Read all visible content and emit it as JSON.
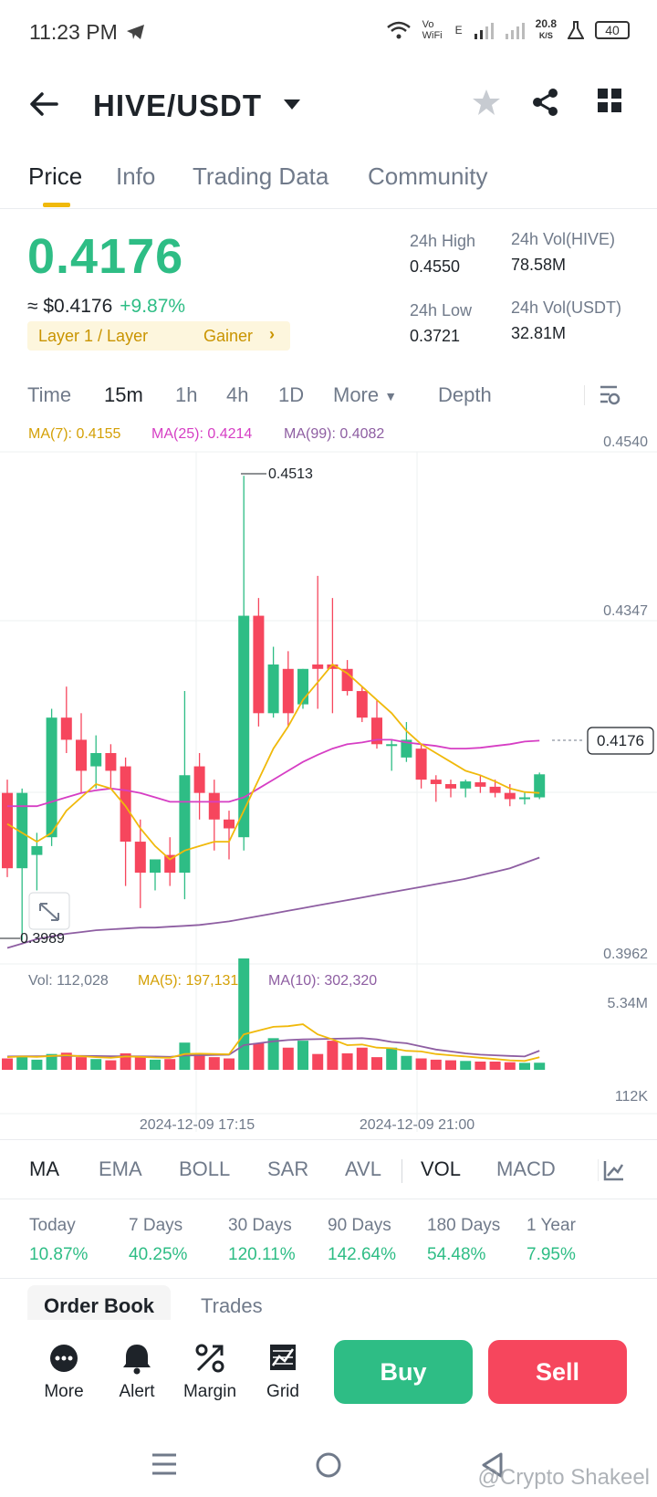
{
  "status_bar": {
    "time": "11:23 PM",
    "net_speed": "20.8",
    "net_unit": "K/S",
    "battery": "40",
    "wifi_label": "Vo WiFi",
    "signal_label": "E"
  },
  "header": {
    "pair": "HIVE/USDT"
  },
  "tabs": [
    {
      "label": "Price",
      "active": true
    },
    {
      "label": "Info",
      "active": false
    },
    {
      "label": "Trading Data",
      "active": false
    },
    {
      "label": "Community",
      "active": false
    }
  ],
  "price": {
    "last": "0.4176",
    "usd": "≈ $0.4176",
    "change": "+9.87%",
    "tag1": "Layer 1 / Layer",
    "tag2": "Gainer",
    "color_up": "#2ebd85",
    "color_down": "#f6465d"
  },
  "stats": {
    "high_label": "24h High",
    "high": "0.4550",
    "low_label": "24h Low",
    "low": "0.3721",
    "vol_base_label": "24h Vol(HIVE)",
    "vol_base": "78.58M",
    "vol_quote_label": "24h Vol(USDT)",
    "vol_quote": "32.81M"
  },
  "intervals": {
    "time": "Time",
    "m15": "15m",
    "h1": "1h",
    "h4": "4h",
    "d1": "1D",
    "more": "More",
    "depth": "Depth",
    "active": "15m"
  },
  "ma_legend": {
    "ma7": "MA(7): 0.4155",
    "ma25": "MA(25): 0.4214",
    "ma99": "MA(99): 0.4082",
    "ma7_color": "#f0b90b",
    "ma25_color": "#d63ec4",
    "ma99_color": "#8e5ea2"
  },
  "vol_legend": {
    "vol": "Vol: 112,028",
    "ma5": "MA(5): 197,131",
    "ma10": "MA(10): 302,320"
  },
  "chart_data": {
    "type": "candlestick",
    "y_axis_labels": [
      "0.4540",
      "0.4347",
      "0.3962"
    ],
    "ylim": [
      0.3962,
      0.454
    ],
    "last_price_label": "0.4176",
    "high_marker": "0.4513",
    "low_marker": "0.3989",
    "x_axis_labels": [
      "2024-12-09 17:15",
      "2024-12-09 21:00"
    ],
    "volume_axis_labels": [
      "5.34M",
      "112K"
    ],
    "candles": [
      {
        "o": 0.4155,
        "h": 0.417,
        "c": 0.407,
        "l": 0.406
      },
      {
        "o": 0.407,
        "h": 0.416,
        "c": 0.4155,
        "l": 0.3989
      },
      {
        "o": 0.4085,
        "h": 0.411,
        "c": 0.4095,
        "l": 0.4045
      },
      {
        "o": 0.4105,
        "h": 0.425,
        "c": 0.424,
        "l": 0.4095
      },
      {
        "o": 0.424,
        "h": 0.4275,
        "c": 0.4215,
        "l": 0.42
      },
      {
        "o": 0.4215,
        "h": 0.4245,
        "c": 0.418,
        "l": 0.4155
      },
      {
        "o": 0.4185,
        "h": 0.422,
        "c": 0.42,
        "l": 0.416
      },
      {
        "o": 0.42,
        "h": 0.421,
        "c": 0.418,
        "l": 0.416
      },
      {
        "o": 0.4185,
        "h": 0.4195,
        "c": 0.41,
        "l": 0.405
      },
      {
        "o": 0.41,
        "h": 0.4125,
        "c": 0.4065,
        "l": 0.4025
      },
      {
        "o": 0.4065,
        "h": 0.408,
        "c": 0.408,
        "l": 0.4045
      },
      {
        "o": 0.4085,
        "h": 0.4105,
        "c": 0.4065,
        "l": 0.405
      },
      {
        "o": 0.4065,
        "h": 0.427,
        "c": 0.4175,
        "l": 0.4035
      },
      {
        "o": 0.4185,
        "h": 0.42,
        "c": 0.4155,
        "l": 0.4125
      },
      {
        "o": 0.4155,
        "h": 0.417,
        "c": 0.4125,
        "l": 0.409
      },
      {
        "o": 0.4125,
        "h": 0.4135,
        "c": 0.4115,
        "l": 0.408
      },
      {
        "o": 0.4105,
        "h": 0.4513,
        "c": 0.4355,
        "l": 0.409
      },
      {
        "o": 0.4355,
        "h": 0.4375,
        "c": 0.4245,
        "l": 0.423
      },
      {
        "o": 0.4245,
        "h": 0.432,
        "c": 0.43,
        "l": 0.424
      },
      {
        "o": 0.4295,
        "h": 0.4315,
        "c": 0.4245,
        "l": 0.423
      },
      {
        "o": 0.4255,
        "h": 0.4295,
        "c": 0.4295,
        "l": 0.425
      },
      {
        "o": 0.43,
        "h": 0.44,
        "c": 0.4295,
        "l": 0.425
      },
      {
        "o": 0.43,
        "h": 0.4375,
        "c": 0.4295,
        "l": 0.4245
      },
      {
        "o": 0.4295,
        "h": 0.4305,
        "c": 0.427,
        "l": 0.4265
      },
      {
        "o": 0.427,
        "h": 0.4275,
        "c": 0.424,
        "l": 0.4235
      },
      {
        "o": 0.424,
        "h": 0.426,
        "c": 0.421,
        "l": 0.4205
      },
      {
        "o": 0.421,
        "h": 0.4215,
        "c": 0.421,
        "l": 0.418
      },
      {
        "o": 0.4195,
        "h": 0.4235,
        "c": 0.4215,
        "l": 0.419
      },
      {
        "o": 0.4205,
        "h": 0.421,
        "c": 0.417,
        "l": 0.416
      },
      {
        "o": 0.417,
        "h": 0.4175,
        "c": 0.4165,
        "l": 0.4145
      },
      {
        "o": 0.4165,
        "h": 0.417,
        "c": 0.416,
        "l": 0.415
      },
      {
        "o": 0.416,
        "h": 0.417,
        "c": 0.4168,
        "l": 0.415
      },
      {
        "o": 0.4167,
        "h": 0.4175,
        "c": 0.4162,
        "l": 0.4155
      },
      {
        "o": 0.4162,
        "h": 0.417,
        "c": 0.4155,
        "l": 0.415
      },
      {
        "o": 0.4155,
        "h": 0.4165,
        "c": 0.4148,
        "l": 0.414
      },
      {
        "o": 0.4148,
        "h": 0.4156,
        "c": 0.415,
        "l": 0.4142
      },
      {
        "o": 0.415,
        "h": 0.4178,
        "c": 0.4176,
        "l": 0.4148
      }
    ],
    "ma7": [
      0.412,
      0.411,
      0.41,
      0.411,
      0.4135,
      0.415,
      0.4165,
      0.416,
      0.414,
      0.4115,
      0.4095,
      0.408,
      0.409,
      0.4095,
      0.41,
      0.41,
      0.4135,
      0.417,
      0.4205,
      0.423,
      0.426,
      0.428,
      0.43,
      0.429,
      0.4275,
      0.426,
      0.4245,
      0.4225,
      0.421,
      0.42,
      0.419,
      0.418,
      0.4175,
      0.4168,
      0.416,
      0.4156,
      0.4155
    ],
    "ma25": [
      0.414,
      0.414,
      0.414,
      0.4145,
      0.415,
      0.4155,
      0.4158,
      0.416,
      0.4158,
      0.4155,
      0.415,
      0.4145,
      0.4145,
      0.4145,
      0.4145,
      0.4145,
      0.415,
      0.416,
      0.417,
      0.418,
      0.419,
      0.4198,
      0.4205,
      0.421,
      0.4212,
      0.4215,
      0.4215,
      0.4212,
      0.421,
      0.4208,
      0.4205,
      0.4205,
      0.4206,
      0.4208,
      0.421,
      0.4213,
      0.4214
    ],
    "ma99": [
      0.398,
      0.3985,
      0.399,
      0.3993,
      0.3996,
      0.3998,
      0.4,
      0.4001,
      0.4002,
      0.4003,
      0.4003,
      0.4004,
      0.4005,
      0.4006,
      0.4008,
      0.401,
      0.4013,
      0.4016,
      0.4019,
      0.4022,
      0.4025,
      0.4028,
      0.4031,
      0.4034,
      0.4037,
      0.404,
      0.4043,
      0.4046,
      0.4049,
      0.4052,
      0.4055,
      0.4058,
      0.4062,
      0.4066,
      0.407,
      0.4076,
      0.4082
    ],
    "volume": [
      180,
      220,
      160,
      250,
      270,
      200,
      170,
      150,
      260,
      200,
      160,
      170,
      430,
      250,
      200,
      180,
      1760,
      420,
      500,
      350,
      460,
      250,
      460,
      260,
      350,
      200,
      350,
      220,
      180,
      160,
      150,
      140,
      130,
      130,
      120,
      110,
      112
    ],
    "vol_ma5": [
      200,
      210,
      205,
      220,
      230,
      215,
      200,
      190,
      210,
      205,
      195,
      190,
      250,
      255,
      250,
      245,
      560,
      620,
      680,
      690,
      720,
      560,
      480,
      390,
      400,
      350,
      340,
      300,
      290,
      250,
      230,
      210,
      190,
      170,
      150,
      140,
      197
    ],
    "vol_ma10": [
      210,
      215,
      215,
      218,
      220,
      220,
      218,
      215,
      215,
      212,
      210,
      205,
      225,
      230,
      235,
      238,
      390,
      420,
      450,
      470,
      480,
      485,
      490,
      495,
      500,
      480,
      440,
      420,
      370,
      320,
      290,
      260,
      240,
      230,
      220,
      210,
      302
    ],
    "vol_max": 1760
  },
  "indicators": [
    {
      "label": "MA",
      "active": true
    },
    {
      "label": "EMA",
      "active": false
    },
    {
      "label": "BOLL",
      "active": false
    },
    {
      "label": "SAR",
      "active": false
    },
    {
      "label": "AVL",
      "active": false
    },
    {
      "label": "VOL",
      "active": true
    },
    {
      "label": "MACD",
      "active": false
    }
  ],
  "performance": [
    {
      "label": "Today",
      "value": "10.87%"
    },
    {
      "label": "7 Days",
      "value": "40.25%"
    },
    {
      "label": "30 Days",
      "value": "120.11%"
    },
    {
      "label": "90 Days",
      "value": "142.64%"
    },
    {
      "label": "180 Days",
      "value": "54.48%"
    },
    {
      "label": "1 Year",
      "value": "7.95%"
    }
  ],
  "orderbook_tabs": {
    "order_book": "Order Book",
    "trades": "Trades"
  },
  "bottom_bar": {
    "more": "More",
    "alert": "Alert",
    "margin": "Margin",
    "grid": "Grid",
    "buy": "Buy",
    "sell": "Sell"
  },
  "credit": "@Crypto Shakeel"
}
